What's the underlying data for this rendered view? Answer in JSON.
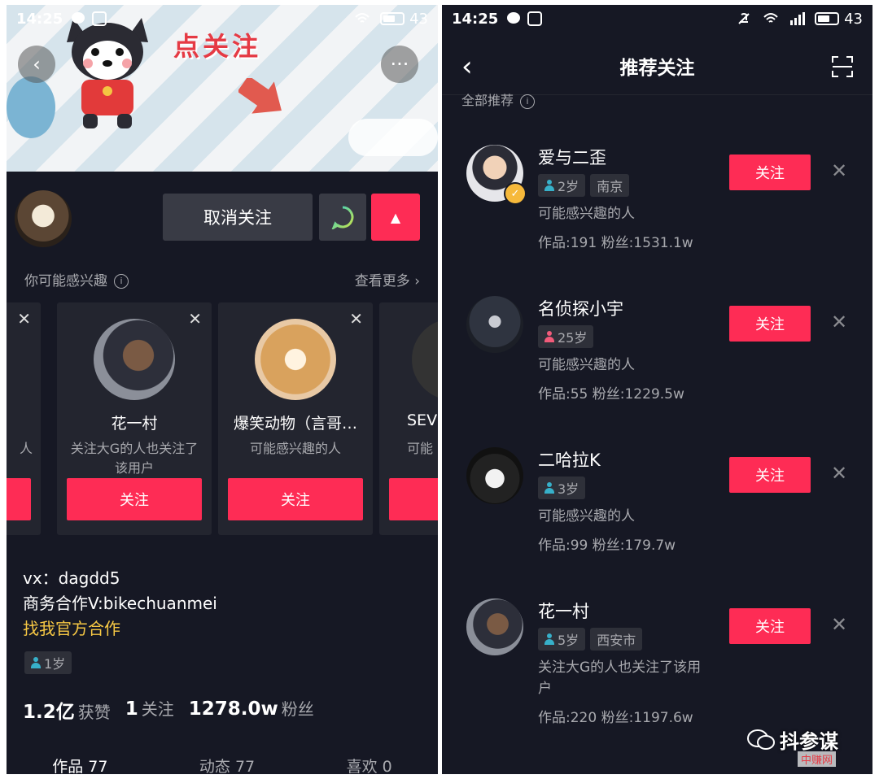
{
  "left": {
    "status": {
      "time": "14:25",
      "battery": "43"
    },
    "banner": {
      "text": "点关注"
    },
    "profile": {
      "unfollow_label": "取消关注",
      "up_label": "▲"
    },
    "suggest": {
      "title": "你可能感兴趣",
      "info": "i",
      "more": "查看更多 ›"
    },
    "cards": [
      {
        "name": "",
        "reason": "人",
        "follow": "",
        "x": "✕"
      },
      {
        "name": "花一村",
        "reason": "关注大G的人也关注了该用户",
        "follow": "关注",
        "x": "✕"
      },
      {
        "name": "爆笑动物（言哥…",
        "reason": "可能感兴趣的人",
        "follow": "关注",
        "x": "✕"
      },
      {
        "name": "SEV",
        "reason": "可能",
        "follow": "",
        "x": ""
      }
    ],
    "bio": {
      "line1": "vx：dagdd5",
      "line2": "商务合作V:bikechuanmei",
      "line3": "找我官方合作"
    },
    "age": "1岁",
    "stats": {
      "likes_num": "1.2亿",
      "likes_label": "获赞",
      "following_num": "1",
      "following_label": "关注",
      "fans_num": "1278.0w",
      "fans_label": "粉丝"
    },
    "tabs": [
      "作品 77",
      "动态 77",
      "喜欢 0"
    ]
  },
  "right": {
    "status": {
      "time": "14:25",
      "battery": "43"
    },
    "title": "推荐关注",
    "back": "‹",
    "section": "全部推荐",
    "rows": [
      {
        "name": "爱与二歪",
        "age": "2岁",
        "city": "南京",
        "gender": "male",
        "reason": "可能感兴趣的人",
        "counts": "作品:191  粉丝:1531.1w",
        "follow": "关注",
        "x": "✕",
        "verified": true
      },
      {
        "name": "名侦探小宇",
        "age": "25岁",
        "city": "",
        "gender": "female",
        "reason": "可能感兴趣的人",
        "counts": "作品:55  粉丝:1229.5w",
        "follow": "关注",
        "x": "✕",
        "verified": false
      },
      {
        "name": "二哈拉K",
        "age": "3岁",
        "city": "",
        "gender": "male",
        "reason": "可能感兴趣的人",
        "counts": "作品:99  粉丝:179.7w",
        "follow": "关注",
        "x": "✕",
        "verified": false
      },
      {
        "name": "花一村",
        "age": "5岁",
        "city": "西安市",
        "gender": "male",
        "reason": "关注大G的人也关注了该用户",
        "counts": "作品:220  粉丝:1197.6w",
        "follow": "关注",
        "x": "✕",
        "verified": false
      }
    ]
  },
  "watermark": {
    "text": "抖参谋",
    "site": "中赚网"
  },
  "colors": {
    "accent": "#fe2c55",
    "bg": "#161824",
    "card": "#23252f",
    "gold": "#f7c844"
  }
}
